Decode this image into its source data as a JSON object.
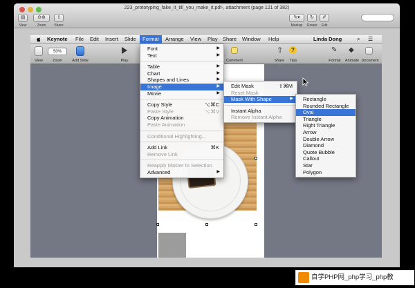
{
  "preview": {
    "title": "223_prototyping_fake_it_till_you_make_it.pdf-, attachment (page 121 of 382)",
    "tools": {
      "view": "View",
      "zoom": "Zoom",
      "share": "Share",
      "markup": "Markup",
      "rotate": "Rotate",
      "edit": "Edit"
    }
  },
  "menubar": {
    "items": [
      "Keynote",
      "File",
      "Edit",
      "Insert",
      "Slide",
      "Format",
      "Arrange",
      "View",
      "Play",
      "Share",
      "Window",
      "Help"
    ],
    "user": "Linda Dong"
  },
  "toolbar": {
    "view": "View",
    "zoom_value": "50%",
    "zoom": "Zoom",
    "add_slide": "Add Slide",
    "play": "Play",
    "comment": "Comment",
    "share": "Share",
    "tips": "Tips",
    "format": "Format",
    "animate": "Animate",
    "document": "Document"
  },
  "format_menu": {
    "g1": [
      {
        "label": "Font",
        "arrow": "▶"
      },
      {
        "label": "Text",
        "arrow": "▶"
      }
    ],
    "g2": [
      {
        "label": "Table",
        "arrow": "▶"
      },
      {
        "label": "Chart",
        "arrow": "▶"
      },
      {
        "label": "Shapes and Lines",
        "arrow": "▶"
      },
      {
        "label": "Image",
        "arrow": "▶"
      },
      {
        "label": "Movie",
        "arrow": "▶"
      }
    ],
    "g3": [
      {
        "label": "Copy Style",
        "shortcut": "⌥⌘C"
      },
      {
        "label": "Paste Style",
        "shortcut": "⌥⌘V"
      },
      {
        "label": "Copy Animation"
      },
      {
        "label": "Paste Animation"
      }
    ],
    "g4": [
      {
        "label": "Conditional Highlighting..."
      }
    ],
    "g5": [
      {
        "label": "Add Link",
        "shortcut": "⌘K"
      },
      {
        "label": "Remove Link"
      }
    ],
    "g6": [
      {
        "label": "Reapply Master to Selection"
      },
      {
        "label": "Advanced",
        "arrow": "▶"
      }
    ]
  },
  "image_menu": {
    "g1": [
      {
        "label": "Edit Mask",
        "shortcut": "⇧⌘M"
      },
      {
        "label": "Reset Mask"
      },
      {
        "label": "Mask With Shape",
        "arrow": "▶"
      }
    ],
    "g2": [
      {
        "label": "Instant Alpha"
      },
      {
        "label": "Remove Instant Alpha"
      }
    ]
  },
  "shape_menu": {
    "items": [
      "Rectangle",
      "Rounded Rectangle",
      "Oval",
      "Triangle",
      "Right Triangle",
      "Arrow",
      "Double Arrow",
      "Diamond",
      "Quote Bubble",
      "Callout",
      "Star",
      "Polygon"
    ]
  },
  "caption": {
    "text": "自学PHP网_php学习_php教"
  },
  "colors": {
    "accent": "#3875d7",
    "canvas": "#747784"
  }
}
